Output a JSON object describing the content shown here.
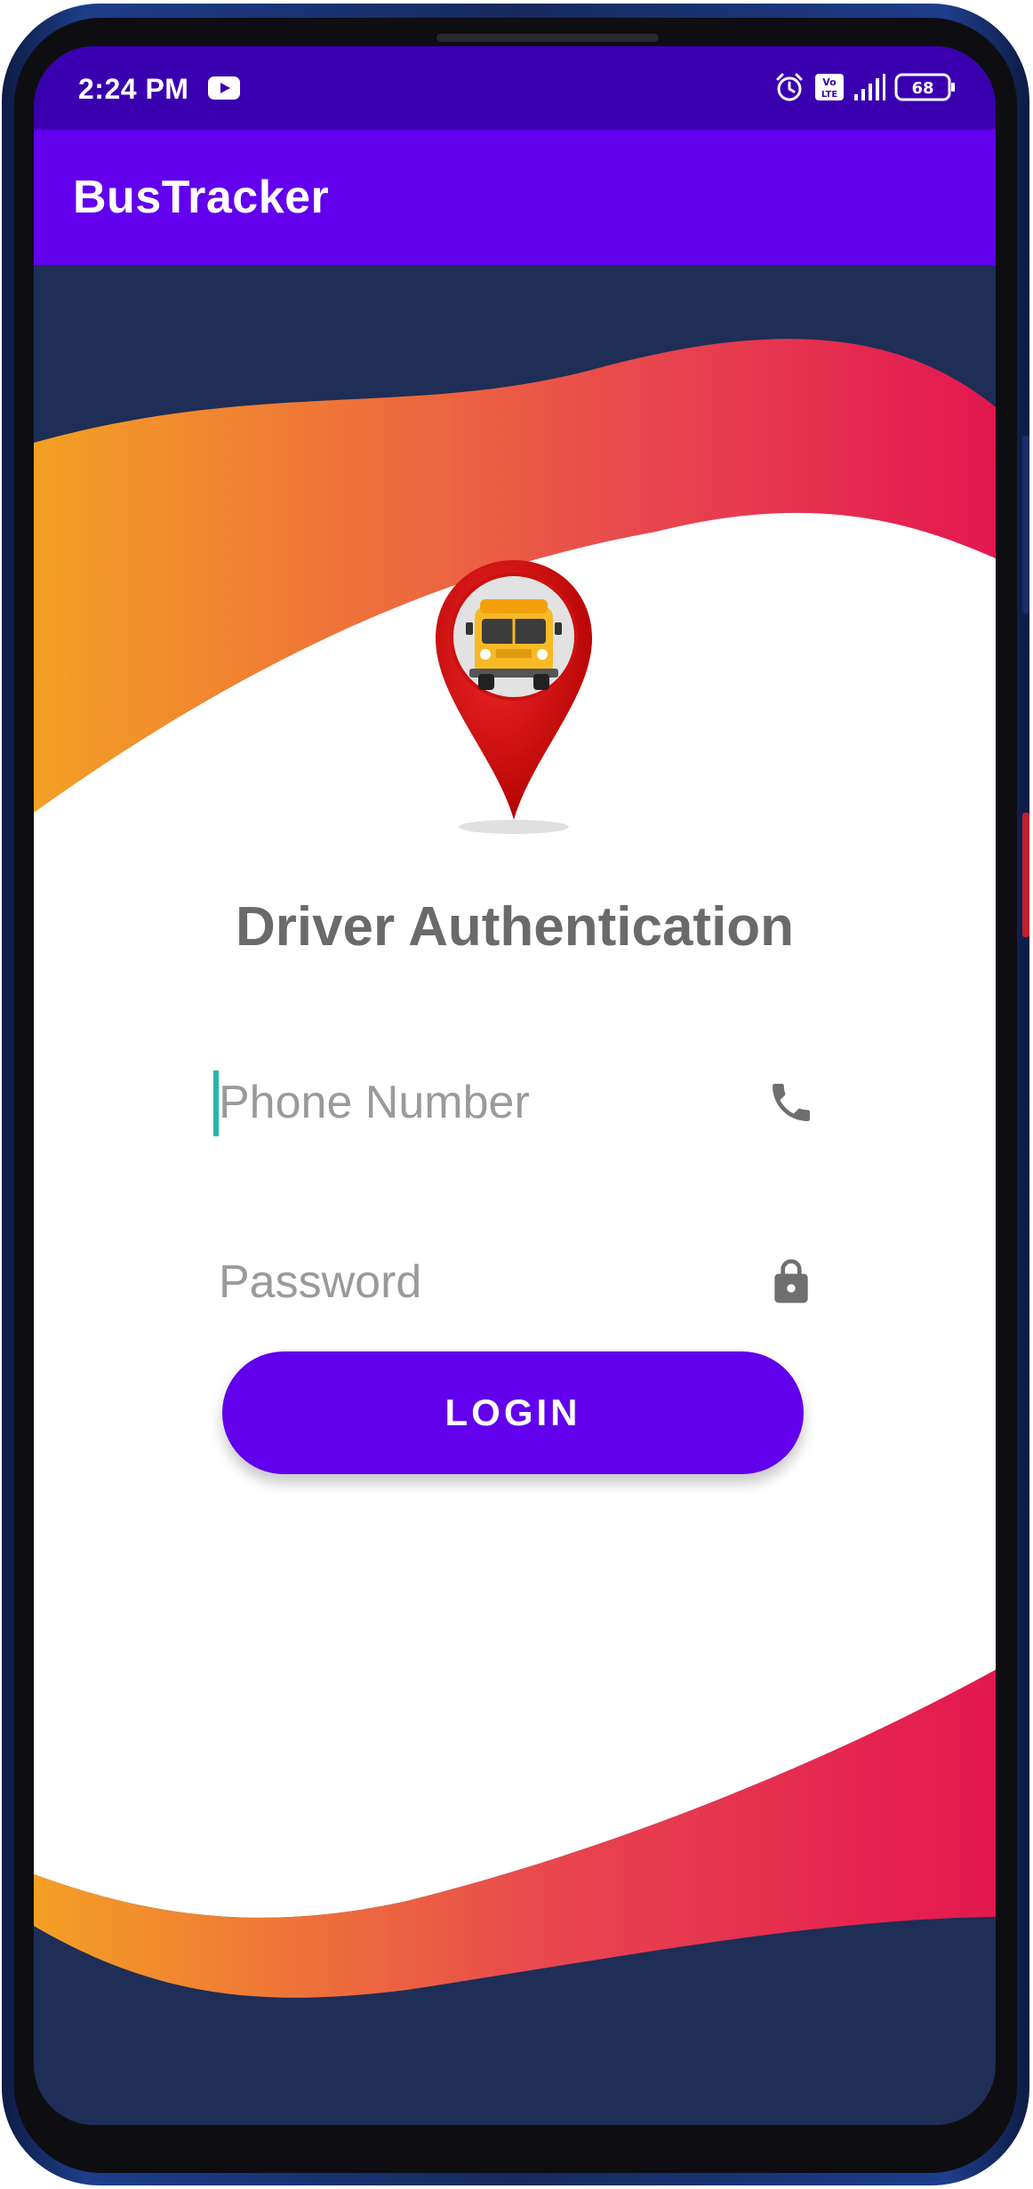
{
  "status_bar": {
    "time": "2:24 PM",
    "left_icons": [
      "youtube-icon"
    ],
    "right_icons": [
      "alarm-icon",
      "volte-icon",
      "signal-icon",
      "battery-icon"
    ],
    "volte_top": "Vo",
    "volte_bottom": "LTE",
    "battery_level": "68",
    "background": "#3a00b0"
  },
  "app_bar": {
    "title": "BusTracker",
    "background": "#6200ee"
  },
  "login_form": {
    "heading": "Driver Authentication",
    "phone": {
      "placeholder": "Phone Number",
      "value": "",
      "icon": "phone-icon"
    },
    "password": {
      "placeholder": "Password",
      "value": "",
      "icon": "lock-icon"
    },
    "login_label": "LOGIN",
    "logo_icon": "map-pin-bus-icon"
  },
  "colors": {
    "accent": "#6200ee",
    "background_navy": "#1e2e56",
    "wave_orange": "#f4a024",
    "wave_pink": "#e3174f",
    "cursor": "#26b6b0",
    "heading_text": "#6a6a6a",
    "icon_gray": "#6f6f6f"
  }
}
